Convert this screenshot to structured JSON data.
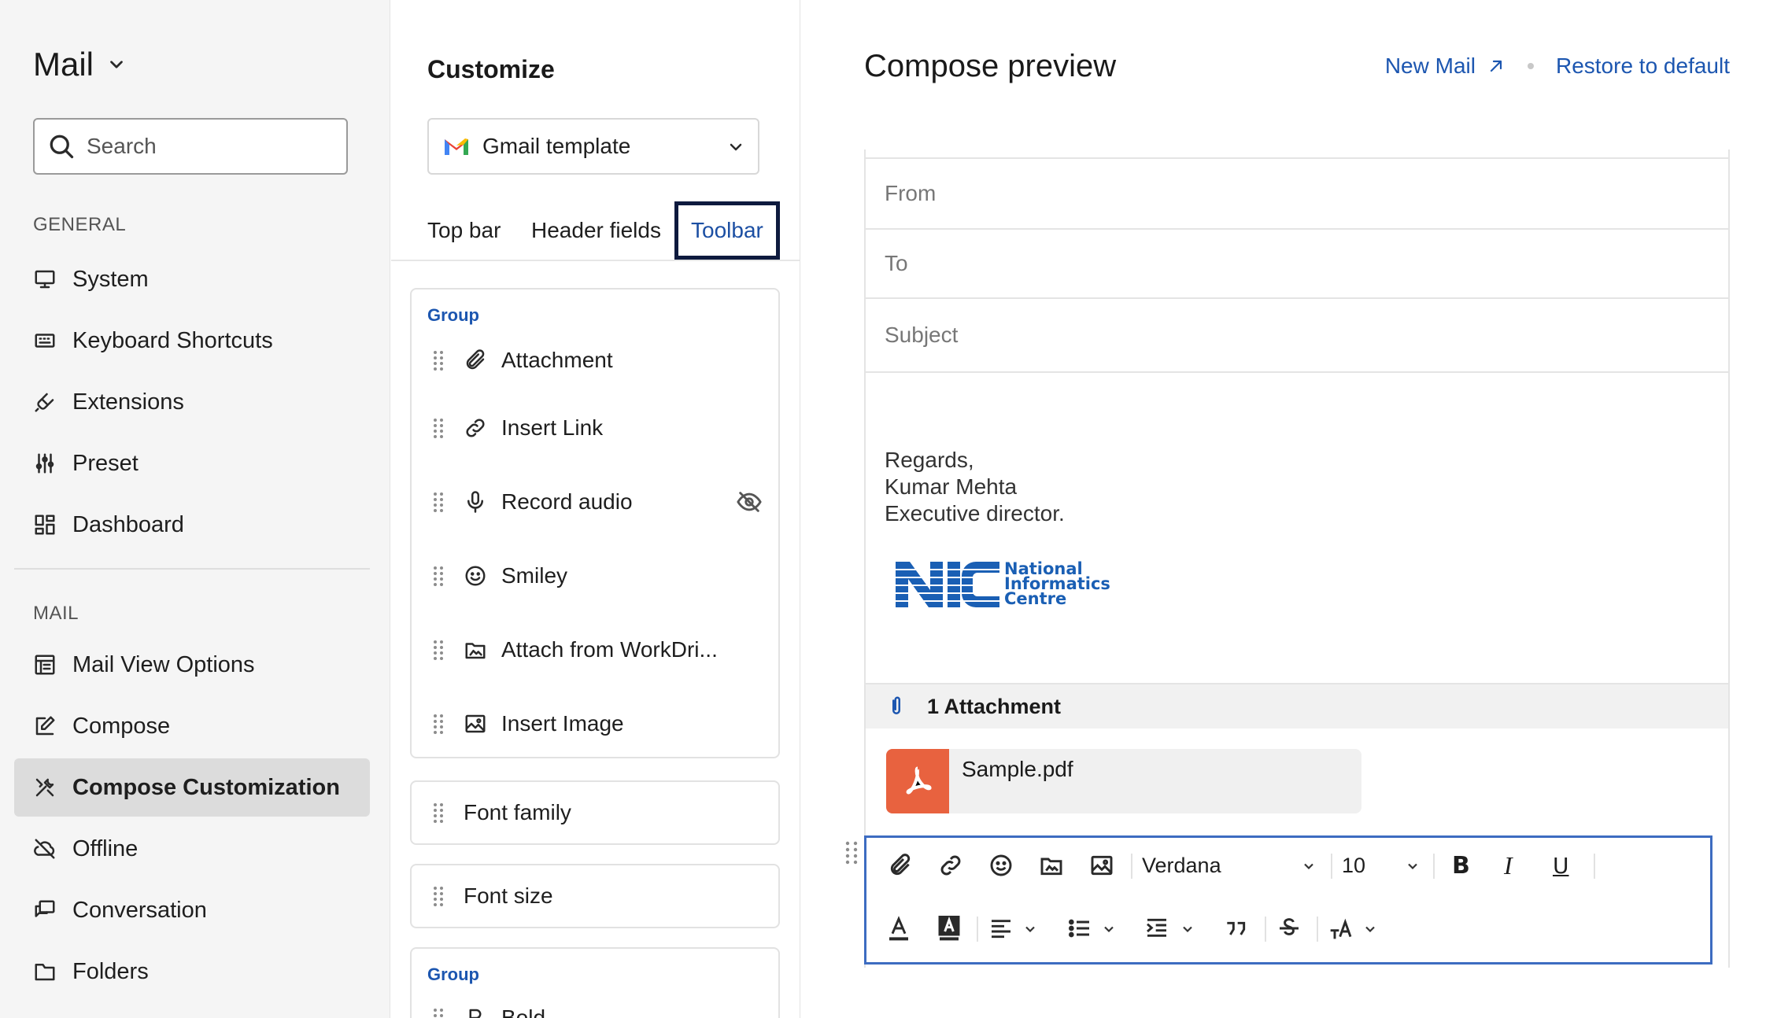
{
  "sidebar": {
    "app_title": "Mail",
    "search_placeholder": "Search",
    "general_label": "GENERAL",
    "mail_label": "MAIL",
    "general_items": [
      {
        "label": "System",
        "icon": "monitor-icon"
      },
      {
        "label": "Keyboard Shortcuts",
        "icon": "keyboard-icon"
      },
      {
        "label": "Extensions",
        "icon": "plug-icon"
      },
      {
        "label": "Preset",
        "icon": "sliders-icon"
      },
      {
        "label": "Dashboard",
        "icon": "dashboard-icon"
      }
    ],
    "mail_items": [
      {
        "label": "Mail View Options",
        "icon": "layout-icon"
      },
      {
        "label": "Compose",
        "icon": "edit-icon"
      },
      {
        "label": "Compose Customization",
        "icon": "tools-icon",
        "active": true
      },
      {
        "label": "Offline",
        "icon": "cloud-off-icon"
      },
      {
        "label": "Conversation",
        "icon": "chat-icon"
      },
      {
        "label": "Folders",
        "icon": "folder-icon"
      }
    ]
  },
  "customize": {
    "title": "Customize",
    "template": "Gmail template",
    "tabs": [
      "Top bar",
      "Header fields",
      "Toolbar"
    ],
    "selected_tab": "Toolbar",
    "group_label": "Group",
    "group1_items": [
      {
        "label": "Attachment",
        "icon": "paperclip-icon"
      },
      {
        "label": "Insert Link",
        "icon": "link-icon"
      },
      {
        "label": "Record audio",
        "icon": "mic-icon",
        "hidden": true
      },
      {
        "label": "Smiley",
        "icon": "smiley-icon"
      },
      {
        "label": "Attach from WorkDri...",
        "icon": "workdrive-icon"
      },
      {
        "label": "Insert Image",
        "icon": "image-icon"
      }
    ],
    "font_family": "Font family",
    "font_size": "Font size",
    "group2_first": "Bold"
  },
  "preview": {
    "title": "Compose preview",
    "new_mail": "New Mail",
    "restore": "Restore to default",
    "from": "From",
    "to": "To",
    "subject": "Subject",
    "signature": [
      "Regards,",
      "Kumar Mehta",
      "Executive director."
    ],
    "logo_text": [
      "National",
      "Informatics",
      "Centre"
    ],
    "logo_mark": "NIC",
    "attachment_heading": "1 Attachment",
    "file_name": "Sample.pdf",
    "toolbar": {
      "font": "Verdana",
      "size": "10",
      "bold": "B",
      "italic": "I",
      "underline": "U"
    }
  },
  "colors": {
    "accent": "#1c56b0",
    "active_nav_bg": "#dcdcdc",
    "pdf": "#e8623f",
    "toolbar_border": "#3d6cc1",
    "logo_blue": "#1a5fb4"
  }
}
